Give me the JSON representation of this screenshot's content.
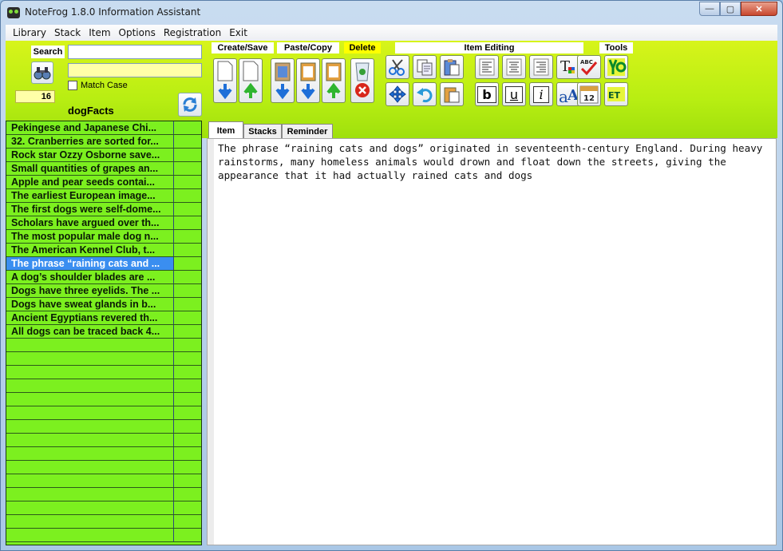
{
  "window": {
    "title": "NoteFrog 1.8.0 Information Assistant",
    "minimize": "—",
    "maximize": "▢",
    "close": "✕"
  },
  "menu": [
    "Library",
    "Stack",
    "Item",
    "Options",
    "Registration",
    "Exit"
  ],
  "search": {
    "label": "Search",
    "value": "",
    "match_case_label": "Match Case",
    "count": "16",
    "stack_name": "dogFacts"
  },
  "toolbar": {
    "groups": {
      "create_save": "Create/Save",
      "paste_copy": "Paste/Copy",
      "delete": "Delete",
      "item_editing": "Item Editing",
      "tools": "Tools"
    },
    "bold": "b",
    "underline": "u",
    "italic": "i",
    "calendar": "12",
    "et": "ET",
    "abc": "ABC"
  },
  "items": [
    "Pekingese and Japanese Chi...",
    "32. Cranberries are sorted for...",
    "Rock star Ozzy Osborne save...",
    "Small quantities of grapes an...",
    "Apple and pear seeds contai...",
    "The earliest European image...",
    "The first dogs were self-dome...",
    "Scholars have argued over th...",
    "The most popular male dog n...",
    "The American Kennel Club, t...",
    "The phrase “raining cats and ...",
    "A dog’s shoulder blades are ...",
    "Dogs have three eyelids. The ...",
    "Dogs have sweat glands in b...",
    "Ancient Egyptians revered th...",
    "All dogs can be traced back 4..."
  ],
  "selected_index": 10,
  "tabs": [
    "Item",
    "Stacks",
    "Reminder"
  ],
  "editor": {
    "text": "The phrase “raining cats and dogs” originated in seventeenth-century England. During heavy rainstorms, many homeless animals would drown and float down the streets, giving the appearance that it had actually rained cats and dogs"
  },
  "colors": {
    "toolbar_green": "#b8ee12",
    "list_green": "#7cf01f",
    "selection_blue": "#3a8ef0",
    "delete_label_yellow": "#ffff00"
  }
}
